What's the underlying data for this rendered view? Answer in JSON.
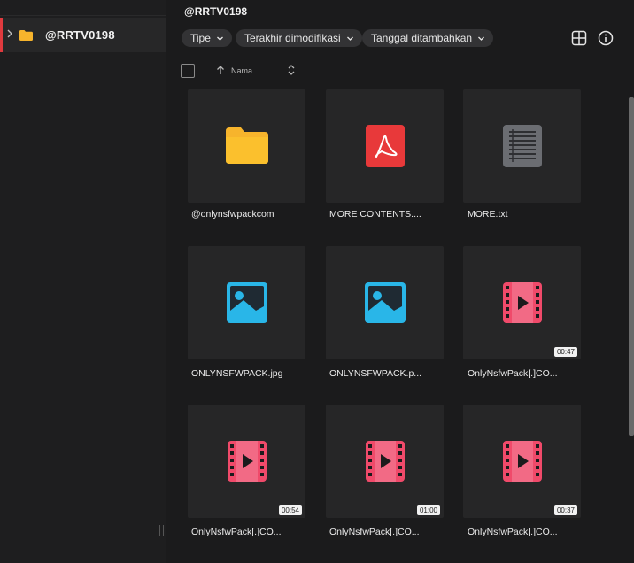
{
  "sidebar": {
    "items": [
      {
        "label": "@RRTV0198",
        "icon": "folder-icon",
        "expanded": false,
        "selected": true
      }
    ]
  },
  "header": {
    "title": "@RRTV0198"
  },
  "filters": [
    {
      "label": "Tipe"
    },
    {
      "label": "Terakhir dimodifikasi"
    },
    {
      "label": "Tanggal ditambahkan"
    }
  ],
  "toolbar": {
    "grid_view_icon": "grid-view-icon",
    "info_icon": "info-icon"
  },
  "sort": {
    "label": "Nama",
    "direction": "ascending"
  },
  "files": [
    {
      "name": "@onlynsfwpackcom",
      "type": "folder"
    },
    {
      "name": "MORE CONTENTS....",
      "type": "pdf"
    },
    {
      "name": "MORE.txt",
      "type": "text"
    },
    {
      "name": "ONLYNSFWPACK.jpg",
      "type": "image"
    },
    {
      "name": "ONLYNSFWPACK.p...",
      "type": "image"
    },
    {
      "name": "OnlyNsfwPack[.]CO...",
      "type": "video",
      "duration": "00:47"
    },
    {
      "name": "OnlyNsfwPack[.]CO...",
      "type": "video",
      "duration": "00:54"
    },
    {
      "name": "OnlyNsfwPack[.]CO...",
      "type": "video",
      "duration": "01:00"
    },
    {
      "name": "OnlyNsfwPack[.]CO...",
      "type": "video",
      "duration": "00:37"
    }
  ],
  "colors": {
    "accent": "#e03a3e",
    "folder": "#f7b42c",
    "pdf": "#e8393a",
    "text_doc": "#6b6d72",
    "image": "#29b6e8",
    "video": "#f04a6a",
    "tile_bg": "#262627",
    "background": "#1b1b1c"
  }
}
